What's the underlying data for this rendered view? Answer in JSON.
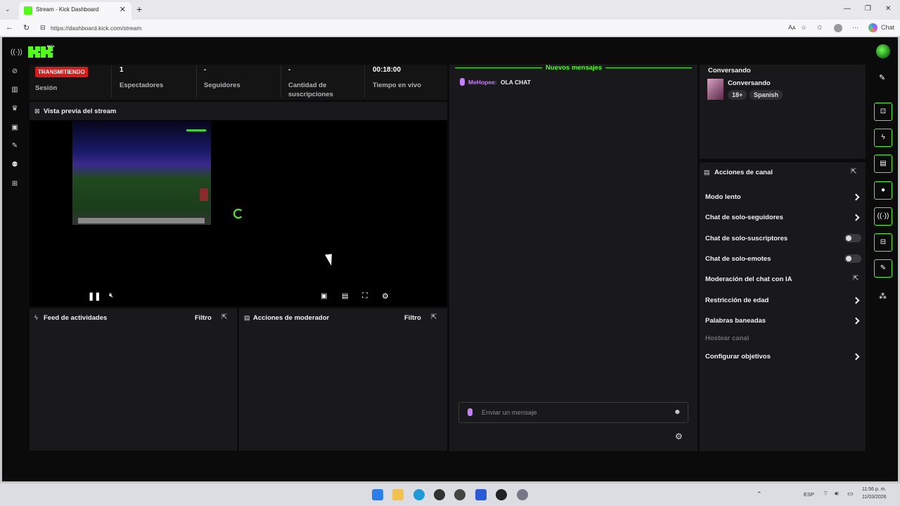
{
  "browser": {
    "tab_title": "Stream - Kick Dashboard",
    "url": "https://dashboard.kick.com/stream",
    "chat_label": "Chat",
    "read_aloud": "Aᴀ"
  },
  "app": {
    "logo_text": "K",
    "logo_beta": "BETA"
  },
  "stats": {
    "live_badge": "TRANSMITIENDO",
    "session_label": "Sesión",
    "viewers_value": "1",
    "viewers_label": "Espectadores",
    "followers_value": "-",
    "followers_label": "Seguidores",
    "subs_value": "-",
    "subs_label_1": "Cantidad de",
    "subs_label_2": "suscripciones",
    "live_time_value": "00:18:00",
    "live_time_label": "Tiempo en vivo"
  },
  "preview": {
    "title": "Vista previa del stream"
  },
  "activity_feed": {
    "title": "Feed de actividades",
    "filter": "Filtro"
  },
  "mod_actions": {
    "title": "Acciones de moderador",
    "filter": "Filtro"
  },
  "chat": {
    "new_messages": "Nuevos mensajes",
    "messages": [
      {
        "user": "MeHopee:",
        "text": "OLA CHAT"
      }
    ],
    "input_placeholder": "Enviar un mensaje"
  },
  "stream_info": {
    "section": "Conversando",
    "category": "Conversando",
    "tags": [
      "18+",
      "Spanish"
    ]
  },
  "channel_actions": {
    "title": "Acciones de canal",
    "items": [
      {
        "label": "Modo lento"
      },
      {
        "label": "Chat de solo-seguidores"
      },
      {
        "label": "Chat de solo-suscriptores"
      },
      {
        "label": "Chat de solo-emotes"
      },
      {
        "label": "Moderación del chat con IA"
      },
      {
        "label": "Restricción de edad"
      },
      {
        "label": "Palabras baneadas"
      },
      {
        "label": "Hostear canal"
      },
      {
        "label": "Configurar objetivos"
      }
    ]
  },
  "taskbar": {
    "lang": "ESP",
    "time": "11:56 p. m.",
    "date": "11/03/2026"
  },
  "colors": {
    "accent": "#53fc18",
    "live": "#d91a1a",
    "chat_user": "#c77dff"
  }
}
